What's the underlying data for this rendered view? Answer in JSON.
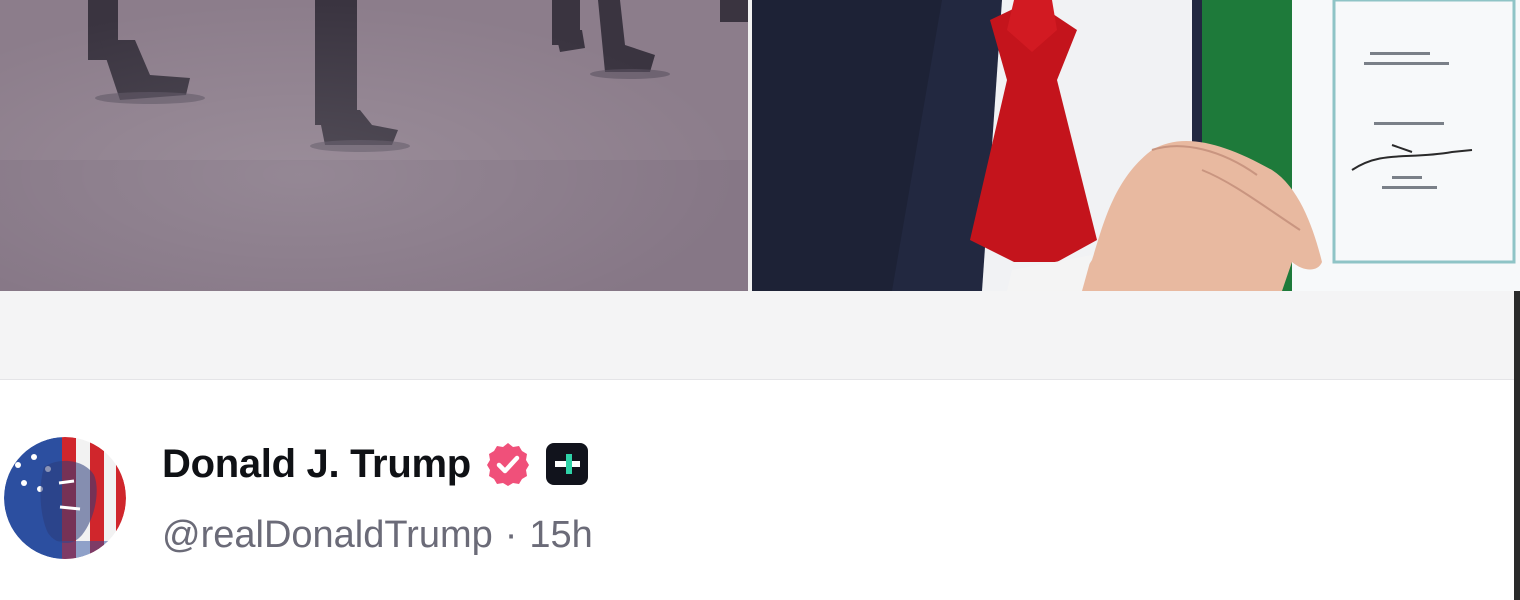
{
  "post": {
    "author": {
      "display_name": "Donald J. Trump",
      "handle": "@realDonaldTrump",
      "avatar": "avatar-image",
      "verified_icon": "verified-badge-icon",
      "verified_color": "#f0507a",
      "extra_badge_icon": "truth-plus-icon"
    },
    "time_separator": "·",
    "time_ago": "15h"
  },
  "media": {
    "items": [
      {
        "name": "photo-people-walking"
      },
      {
        "name": "photo-signed-document"
      }
    ]
  }
}
